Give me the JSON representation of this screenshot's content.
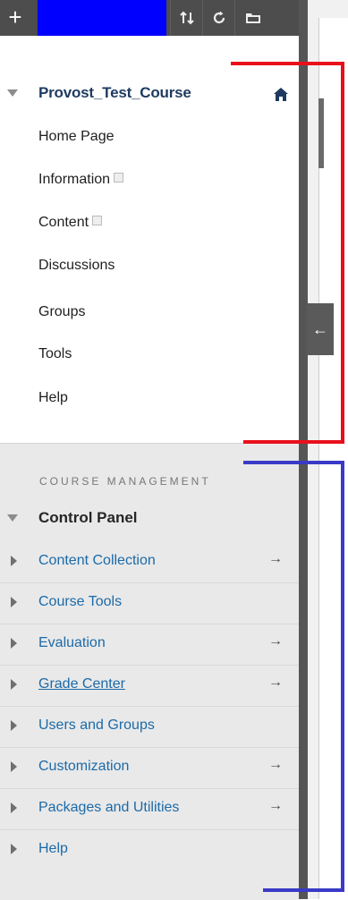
{
  "topbar": {
    "plus_label": "+",
    "sort_icon": "sort-icon",
    "refresh_icon": "refresh-icon",
    "folder_icon": "folder-icon"
  },
  "course": {
    "title": "Provost_Test_Course",
    "nav": [
      "Home Page",
      "Information",
      "Content",
      "Discussions",
      "Groups",
      "Tools",
      "Help"
    ]
  },
  "management": {
    "header": "COURSE MANAGEMENT",
    "panel_title": "Control Panel",
    "tools": [
      {
        "label": "Content Collection",
        "arrow": "→"
      },
      {
        "label": "Course Tools",
        "arrow": ""
      },
      {
        "label": "Evaluation",
        "arrow": "→"
      },
      {
        "label": "Grade Center",
        "arrow": "→"
      },
      {
        "label": "Users and Groups",
        "arrow": ""
      },
      {
        "label": "Customization",
        "arrow": "→"
      },
      {
        "label": "Packages and Utilities",
        "arrow": "→"
      },
      {
        "label": "Help",
        "arrow": ""
      }
    ]
  },
  "collapse_label": "←",
  "colors": {
    "annotation_red": "#e8101b",
    "annotation_blue": "#3a3ac8",
    "topbar_blue": "#0000ff"
  }
}
